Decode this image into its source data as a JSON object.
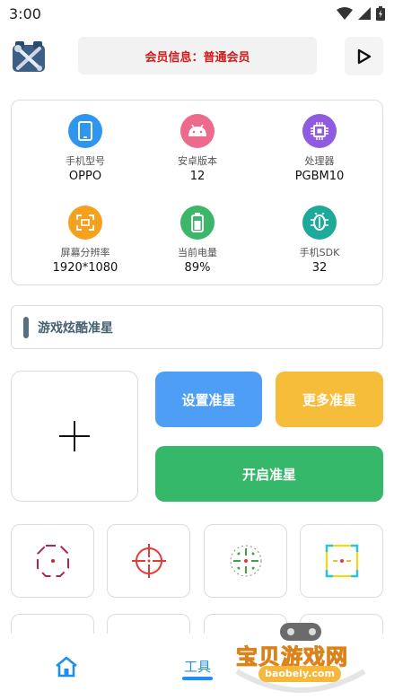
{
  "status_bar": {
    "time": "3:00"
  },
  "header": {
    "member_info": "会员信息：普通会员"
  },
  "device_info": [
    {
      "icon": "phone-icon",
      "label": "手机型号",
      "value": "OPPO",
      "color": "#2f96f0"
    },
    {
      "icon": "android-icon",
      "label": "安卓版本",
      "value": "12",
      "color": "#ec6b8d"
    },
    {
      "icon": "cpu-icon",
      "label": "处理器",
      "value": "PGBM10",
      "color": "#8f5be0"
    },
    {
      "icon": "screen-resolution-icon",
      "label": "屏幕分辨率",
      "value": "1920*1080",
      "color": "#f6a11d"
    },
    {
      "icon": "battery-icon",
      "label": "当前电量",
      "value": "89%",
      "color": "#3eb66a"
    },
    {
      "icon": "sdk-icon",
      "label": "手机SDK",
      "value": "32",
      "color": "#1fa99a"
    }
  ],
  "section": {
    "title": "游戏炫酷准星"
  },
  "buttons": {
    "set": "设置准星",
    "more": "更多准星",
    "open": "开启准星"
  },
  "crosshairs": [
    {
      "icon": "crosshair-octagon-icon",
      "color": "#c2185b"
    },
    {
      "icon": "crosshair-target-icon",
      "color": "#e53935"
    },
    {
      "icon": "crosshair-dashed-icon",
      "color": "#43a047"
    },
    {
      "icon": "crosshair-gradient-square-icon",
      "color": "#ffd600"
    }
  ],
  "tabbar": {
    "tools_label": "工具"
  },
  "watermark": {
    "text": "宝贝游戏网",
    "url": "baobeiy.com"
  }
}
